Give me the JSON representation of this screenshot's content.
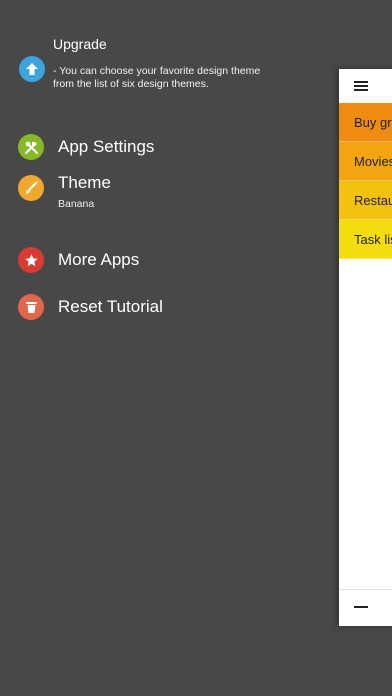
{
  "menu": {
    "upgrade": {
      "title": "Upgrade",
      "description": "- You can choose your favorite design theme from the list of six design themes.",
      "icon": "arrow-up-icon",
      "color": "#3fa4dd"
    },
    "app_settings": {
      "label": "App Settings",
      "icon": "tools-icon",
      "color": "#86b82a"
    },
    "theme": {
      "label": "Theme",
      "value": "Banana",
      "icon": "brush-icon",
      "color": "#f0a92e"
    },
    "more_apps": {
      "label": "More Apps",
      "icon": "star-icon",
      "color": "#d83b34"
    },
    "reset_tutorial": {
      "label": "Reset Tutorial",
      "icon": "trash-icon",
      "color": "#e2674a"
    }
  },
  "list_panel": {
    "menu_icon": "hamburger-icon",
    "add_icon": "minus-icon",
    "items": [
      {
        "label": "Buy groceries",
        "color": "#f08c12"
      },
      {
        "label": "Movies",
        "color": "#f2a411"
      },
      {
        "label": "Restaurants",
        "color": "#f3c20f"
      },
      {
        "label": "Task list",
        "color": "#f4dd0e"
      }
    ]
  }
}
